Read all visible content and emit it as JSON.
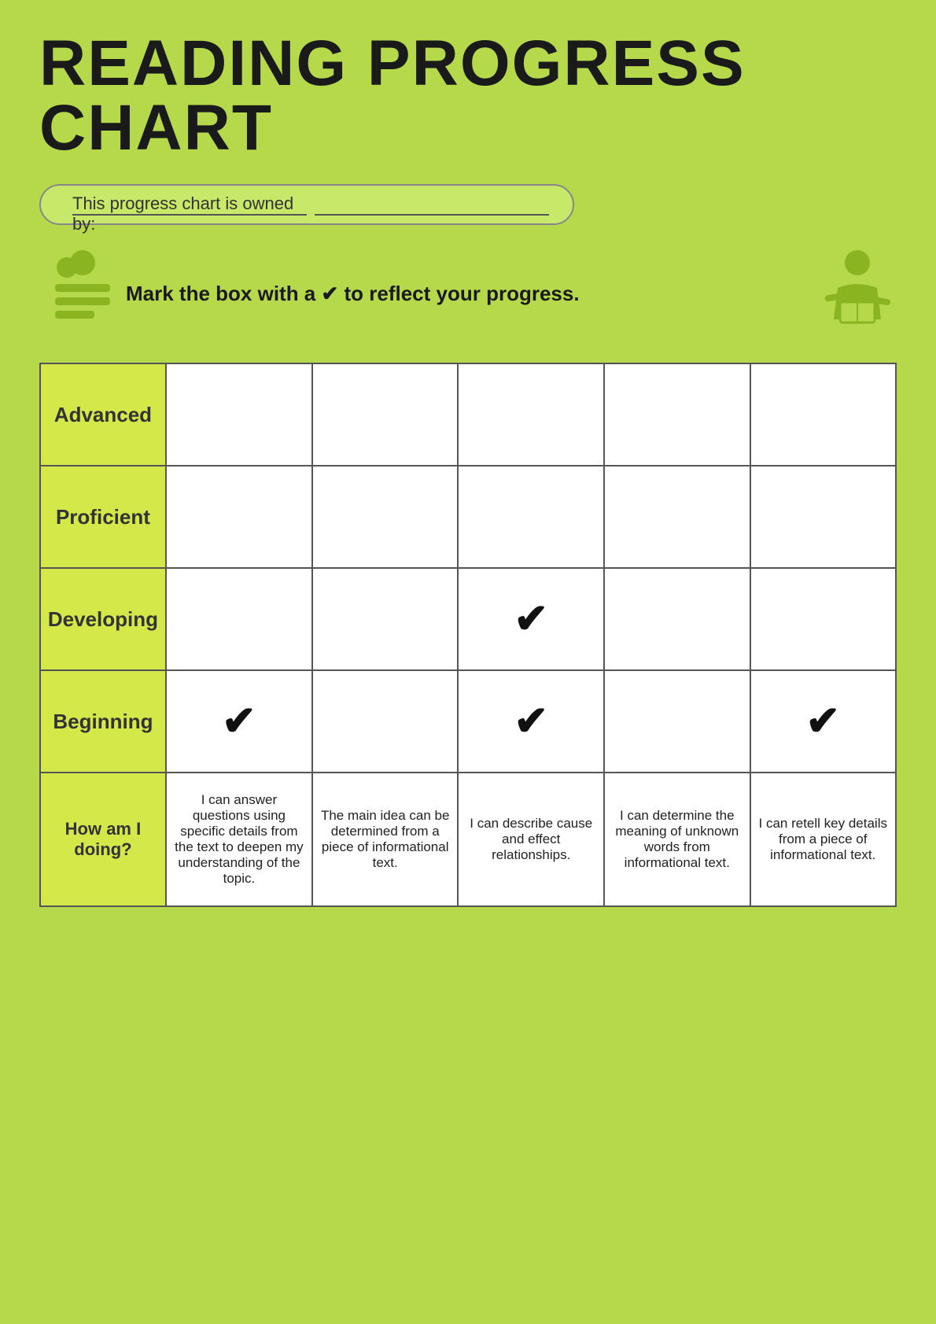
{
  "title": "READING PROGRESS CHART",
  "owner_label": "This progress chart is owned by:",
  "instruction": "Mark the box with a ✔ to reflect your progress.",
  "rows": [
    {
      "label": "Advanced",
      "checks": [
        false,
        false,
        false,
        false,
        false
      ]
    },
    {
      "label": "Proficient",
      "checks": [
        false,
        false,
        false,
        false,
        false
      ]
    },
    {
      "label": "Developing",
      "checks": [
        false,
        false,
        true,
        false,
        false
      ]
    },
    {
      "label": "Beginning",
      "checks": [
        true,
        false,
        true,
        false,
        true
      ]
    }
  ],
  "how_am_i_label": "How am I doing?",
  "descriptors": [
    "I can answer questions using specific details from the text to deepen my understanding of the topic.",
    "The main idea can be determined from a piece of informational text.",
    "I can describe cause and effect relationships.",
    "I can determine the meaning of unknown words from informational text.",
    "I can retell key details from a piece of informational text."
  ],
  "checkmark": "✔"
}
